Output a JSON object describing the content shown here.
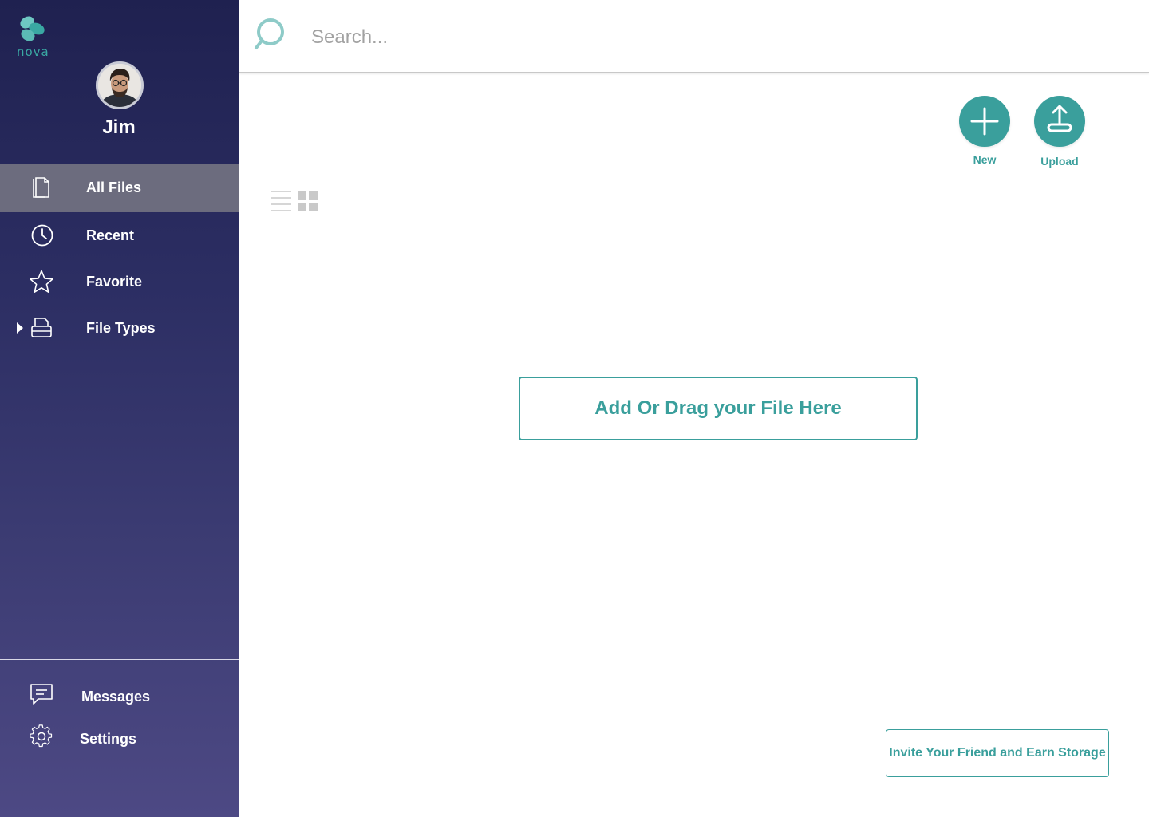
{
  "brand": {
    "name": "nova",
    "accent": "#3a9f9c"
  },
  "user": {
    "name": "Jim"
  },
  "sidebar": {
    "items": [
      {
        "label": "All Files",
        "icon": "files-icon",
        "active": true
      },
      {
        "label": "Recent",
        "icon": "clock-icon",
        "active": false
      },
      {
        "label": "Favorite",
        "icon": "star-icon",
        "active": false
      },
      {
        "label": "File Types",
        "icon": "printer-icon",
        "active": false,
        "expandable": true
      }
    ],
    "bottom": [
      {
        "label": "Messages",
        "icon": "chat-icon"
      },
      {
        "label": "Settings",
        "icon": "gear-icon"
      }
    ]
  },
  "search": {
    "placeholder": "Search..."
  },
  "actions": {
    "new_label": "New",
    "upload_label": "Upload"
  },
  "dropzone": {
    "label": "Add Or Drag your File Here"
  },
  "invite": {
    "label": "Invite Your Friend and Earn Storage"
  }
}
